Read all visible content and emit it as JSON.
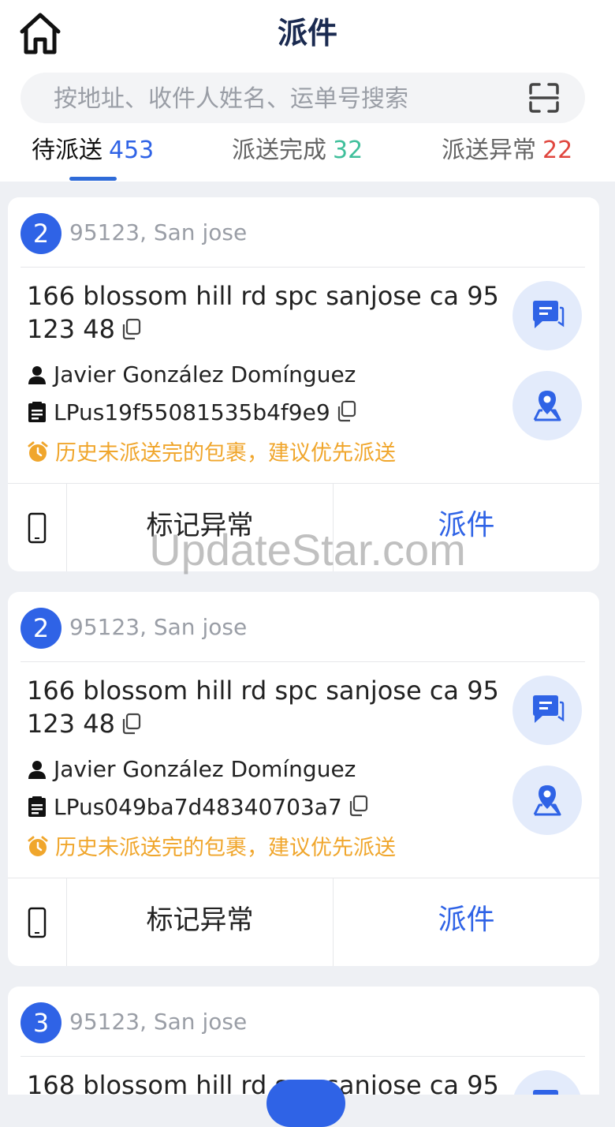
{
  "header": {
    "title": "派件",
    "search_placeholder": "按地址、收件人姓名、运单号搜索"
  },
  "tabs": [
    {
      "label": "待派送",
      "count": "453",
      "count_color": "#2f63e6",
      "active": true
    },
    {
      "label": "派送完成",
      "count": "32",
      "count_color": "#3fbf9b",
      "active": false
    },
    {
      "label": "派送异常",
      "count": "22",
      "count_color": "#e0463e",
      "active": false
    }
  ],
  "cards": [
    {
      "seq": "2",
      "zip_city": "95123, San jose",
      "address": "166 blossom hill rd spc sanjose ca 95 123 48",
      "recipient": "Javier González Domínguez",
      "tracking": "LPus19f55081535b4f9e9",
      "warning": "历史未派送完的包裹，建议优先派送",
      "mark_label": "标记异常",
      "dispatch_label": "派件"
    },
    {
      "seq": "2",
      "zip_city": "95123, San jose",
      "address": "166 blossom hill rd spc sanjose ca 95 123 48",
      "recipient": "Javier González Domínguez",
      "tracking": "LPus049ba7d48340703a7",
      "warning": "历史未派送完的包裹，建议优先派送",
      "mark_label": "标记异常",
      "dispatch_label": "派件"
    },
    {
      "seq": "3",
      "zip_city": "95123, San jose",
      "address": "168 blossom hill rd spc sanjose ca 95"
    }
  ],
  "watermark": "UpdateStar.com",
  "colors": {
    "accent": "#2f63e6",
    "warning": "#f0a62c",
    "background": "#eef0f4"
  }
}
